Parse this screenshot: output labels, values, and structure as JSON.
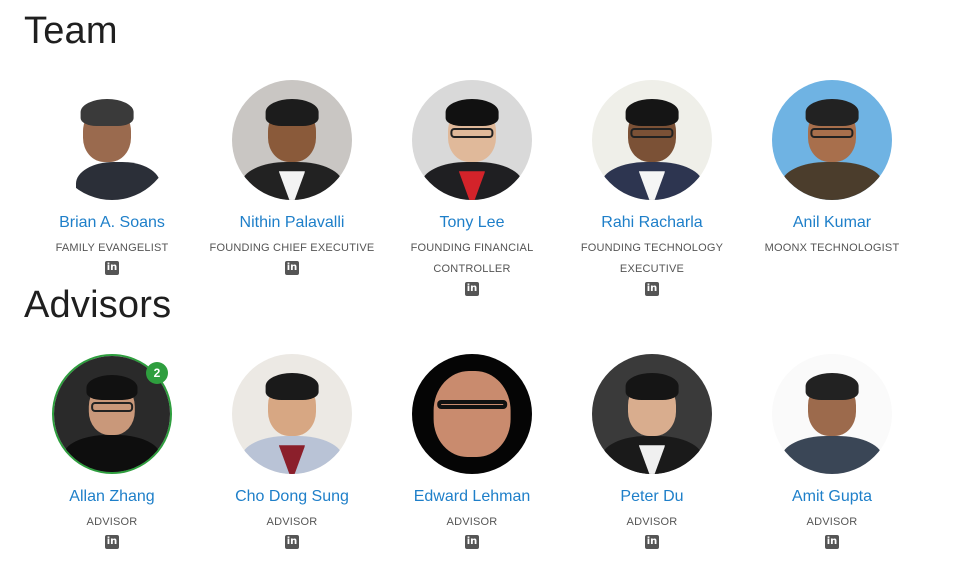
{
  "team": {
    "title": "Team",
    "members": [
      {
        "name": "Brian A. Soans",
        "role": "FAMILY EVANGELIST",
        "linkedin_icon": "in"
      },
      {
        "name": "Nithin Palavalli",
        "role": "FOUNDING CHIEF EXECUTIVE",
        "linkedin_icon": "in"
      },
      {
        "name": "Tony Lee",
        "role": "FOUNDING FINANCIAL CONTROLLER",
        "linkedin_icon": "in"
      },
      {
        "name": "Rahi Racharla",
        "role": "FOUNDING TECHNOLOGY EXECUTIVE",
        "linkedin_icon": "in"
      },
      {
        "name": "Anil Kumar",
        "role": "MOONX TECHNOLOGIST"
      }
    ]
  },
  "advisors": {
    "title": "Advisors",
    "members": [
      {
        "name": "Allan Zhang",
        "role": "ADVISOR",
        "linkedin_icon": "in",
        "badge": "2"
      },
      {
        "name": "Cho Dong Sung",
        "role": "ADVISOR",
        "linkedin_icon": "in"
      },
      {
        "name": "Edward Lehman",
        "role": "ADVISOR",
        "linkedin_icon": "in"
      },
      {
        "name": "Peter Du",
        "role": "ADVISOR",
        "linkedin_icon": "in"
      },
      {
        "name": "Amit Gupta",
        "role": "ADVISOR",
        "linkedin_icon": "in"
      }
    ]
  },
  "colors": {
    "name_link": "#1e7fc9",
    "badge": "#2e9e3e",
    "icon": "#555555"
  }
}
